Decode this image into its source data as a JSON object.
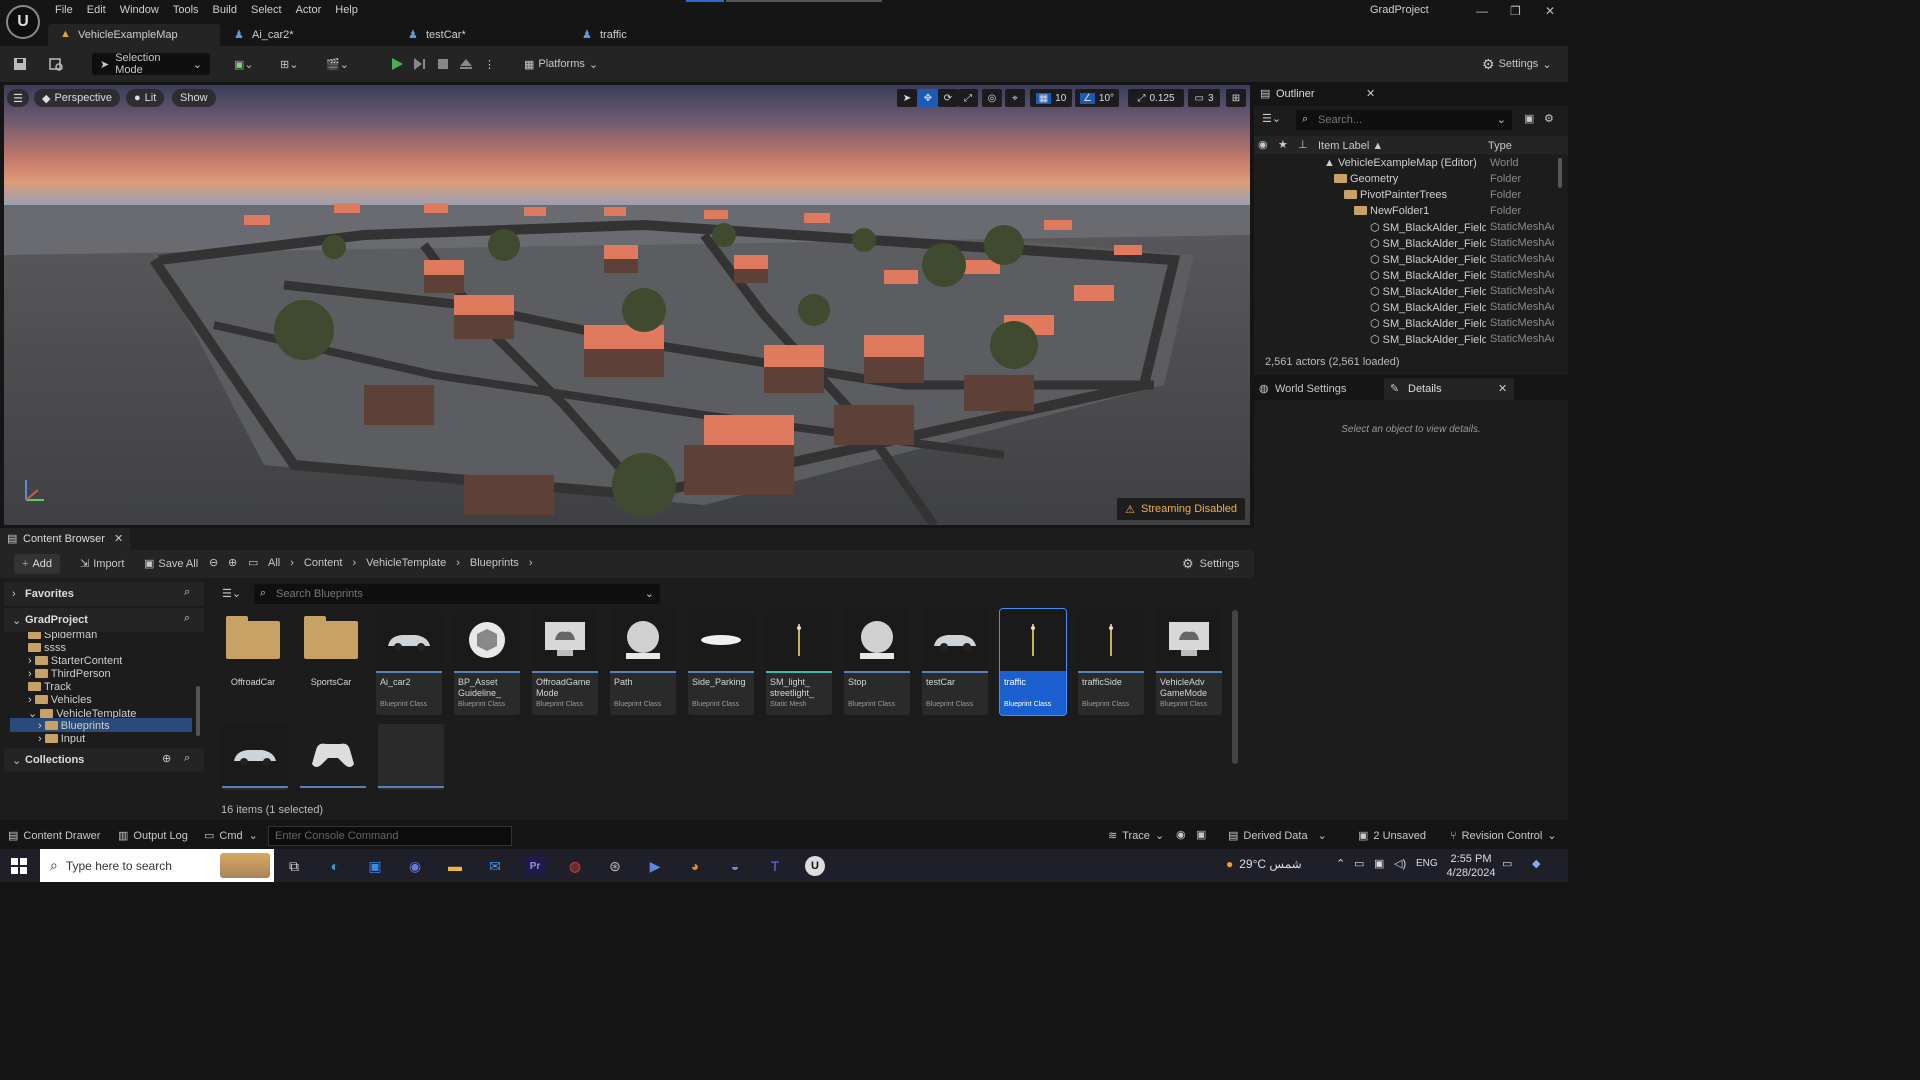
{
  "menu": [
    "File",
    "Edit",
    "Window",
    "Tools",
    "Build",
    "Select",
    "Actor",
    "Help"
  ],
  "project_name": "GradProject",
  "tabs": [
    {
      "label": "VehicleExampleMap",
      "active": true
    },
    {
      "label": "Ai_car2*",
      "active": false
    },
    {
      "label": "testCar*",
      "active": false
    },
    {
      "label": "traffic",
      "active": false
    }
  ],
  "toolbar": {
    "selection_mode": "Selection Mode",
    "platforms": "Platforms",
    "settings": "Settings"
  },
  "viewport": {
    "perspective": "Perspective",
    "lit": "Lit",
    "show": "Show",
    "grid_snap": "10",
    "rot_snap": "10°",
    "scale_snap": "0.125",
    "cam_speed": "3",
    "streaming": "Streaming Disabled"
  },
  "outliner": {
    "title": "Outliner",
    "search_placeholder": "Search...",
    "col_label": "Item Label ▲",
    "col_type": "Type",
    "rows": [
      {
        "label": "VehicleExampleMap (Editor)",
        "type": "World"
      },
      {
        "label": "Geometry",
        "type": "Folder"
      },
      {
        "label": "PivotPainterTrees",
        "type": "Folder"
      },
      {
        "label": "NewFolder1",
        "type": "Folder"
      },
      {
        "label": "SM_BlackAlder_Field",
        "type": "StaticMeshActor"
      },
      {
        "label": "SM_BlackAlder_Field",
        "type": "StaticMeshActor"
      },
      {
        "label": "SM_BlackAlder_Field",
        "type": "StaticMeshActor"
      },
      {
        "label": "SM_BlackAlder_Field",
        "type": "StaticMeshActor"
      },
      {
        "label": "SM_BlackAlder_Field",
        "type": "StaticMeshActor"
      },
      {
        "label": "SM_BlackAlder_Field",
        "type": "StaticMeshActor"
      },
      {
        "label": "SM_BlackAlder_Field",
        "type": "StaticMeshActor"
      },
      {
        "label": "SM_BlackAlder_Field",
        "type": "StaticMeshActor"
      }
    ],
    "actor_count": "2,561 actors (2,561 loaded)"
  },
  "details": {
    "world_settings": "World Settings",
    "title": "Details",
    "empty_msg": "Select an object to view details."
  },
  "content_browser": {
    "title": "Content Browser",
    "add": "Add",
    "import": "Import",
    "save_all": "Save All",
    "settings": "Settings",
    "breadcrumb": [
      "All",
      "Content",
      "VehicleTemplate",
      "Blueprints"
    ],
    "favorites": "Favorites",
    "project": "GradProject",
    "collections": "Collections",
    "search_placeholder": "Search Blueprints",
    "tree": [
      {
        "label": "Spiderman",
        "expandable": false
      },
      {
        "label": "ssss",
        "expandable": false
      },
      {
        "label": "StarterContent",
        "expandable": true
      },
      {
        "label": "ThirdPerson",
        "expandable": true
      },
      {
        "label": "Track",
        "expandable": false
      },
      {
        "label": "Vehicles",
        "expandable": true
      },
      {
        "label": "VehicleTemplate",
        "expandable": true
      },
      {
        "label": "Blueprints",
        "expandable": true
      },
      {
        "label": "Input",
        "expandable": true
      }
    ],
    "folders": [
      "OffroadCar",
      "SportsCar"
    ],
    "assets": [
      {
        "name": "Ai_car2",
        "cls": "Blueprint Class",
        "thumb": "car-thumb-icon"
      },
      {
        "name": "BP_Asset Guideline_",
        "cls": "Blueprint Class",
        "thumb": "cube-thumb-icon"
      },
      {
        "name": "OffroadGame Mode",
        "cls": "Blueprint Class",
        "thumb": "gamemode-thumb-icon"
      },
      {
        "name": "Path",
        "cls": "Blueprint Class",
        "thumb": "sphere-thumb-icon"
      },
      {
        "name": "Side_Parking",
        "cls": "Blueprint Class",
        "thumb": "disc-thumb-icon"
      },
      {
        "name": "SM_light_ streetlight_",
        "cls": "Static Mesh",
        "thumb": "streetlight-thumb-icon"
      },
      {
        "name": "Stop",
        "cls": "Blueprint Class",
        "thumb": "sphere-thumb-icon"
      },
      {
        "name": "testCar",
        "cls": "Blueprint Class",
        "thumb": "car-thumb-icon"
      },
      {
        "name": "traffic",
        "cls": "Blueprint Class",
        "thumb": "streetlight-thumb-icon"
      },
      {
        "name": "trafficSide",
        "cls": "Blueprint Class",
        "thumb": "streetlight-thumb-icon"
      },
      {
        "name": "VehicleAdv GameMode",
        "cls": "Blueprint Class",
        "thumb": "gamemode-thumb-icon"
      }
    ],
    "status": "16 items (1 selected)"
  },
  "statusbar": {
    "content_drawer": "Content Drawer",
    "output_log": "Output Log",
    "cmd": "Cmd",
    "console_placeholder": "Enter Console Command",
    "trace": "Trace",
    "derived_data": "Derived Data",
    "unsaved": "2 Unsaved",
    "revision_control": "Revision Control"
  },
  "taskbar": {
    "search_placeholder": "Type here to search",
    "weather": "29°C شمس",
    "language": "ENG",
    "time": "2:55 PM",
    "date": "4/28/2024"
  }
}
